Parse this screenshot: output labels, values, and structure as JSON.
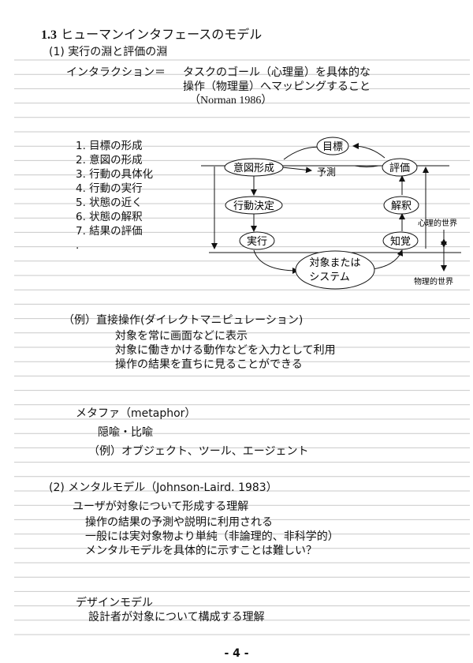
{
  "section": {
    "number": "1.3",
    "title": "ヒューマンインタフェースのモデル"
  },
  "sub1": {
    "label": "(1) 実行の淵と評価の淵"
  },
  "interaction": {
    "term": "インタラクション＝",
    "def1": "タスクのゴール（心理量）を具体的な",
    "def2": "操作（物理量）へマッピングすること",
    "cite": "（Norman 1986）"
  },
  "steps": [
    "1. 目標の形成",
    "2. 意図の形成",
    "3. 行動の具体化",
    "4. 行動の実行",
    "5. 状態の近く",
    "6. 状態の解釈",
    "7. 結果の評価",
    "."
  ],
  "diagram": {
    "goal": "目標",
    "intent": "意図形成",
    "predict": "予測",
    "evaluate": "評価",
    "action": "行動決定",
    "interpret": "解釈",
    "execute": "実行",
    "perceive": "知覚",
    "system1": "対象または",
    "system2": "システム",
    "mental_world": "心理的世界",
    "physical_world": "物理的世界"
  },
  "example1": {
    "heading": "（例）直接操作(ダイレクトマニピュレーション)",
    "lines": [
      "対象を常に画面などに表示",
      "対象に働きかける動作などを入力として利用",
      "操作の結果を直ちに見ることができる"
    ]
  },
  "metaphor": {
    "heading": "メタファ（metaphor）",
    "sub": "隠喩・比喩",
    "example": "（例）オブジェクト、ツール、エージェント"
  },
  "sub2": {
    "label": "(2) メンタルモデル（Johnson-Laird. 1983）"
  },
  "mental": {
    "line1": "ユーザが対象について形成する理解",
    "line2": "操作の結果の予測や説明に利用される",
    "line3": "一般には実対象物より単純（非論理的、非科学的）",
    "line4": "メンタルモデルを具体的に示すことは難しい？"
  },
  "design": {
    "heading": "デザインモデル",
    "line": "設計者が対象について構成する理解"
  },
  "footer": {
    "page": "- 4 -"
  }
}
